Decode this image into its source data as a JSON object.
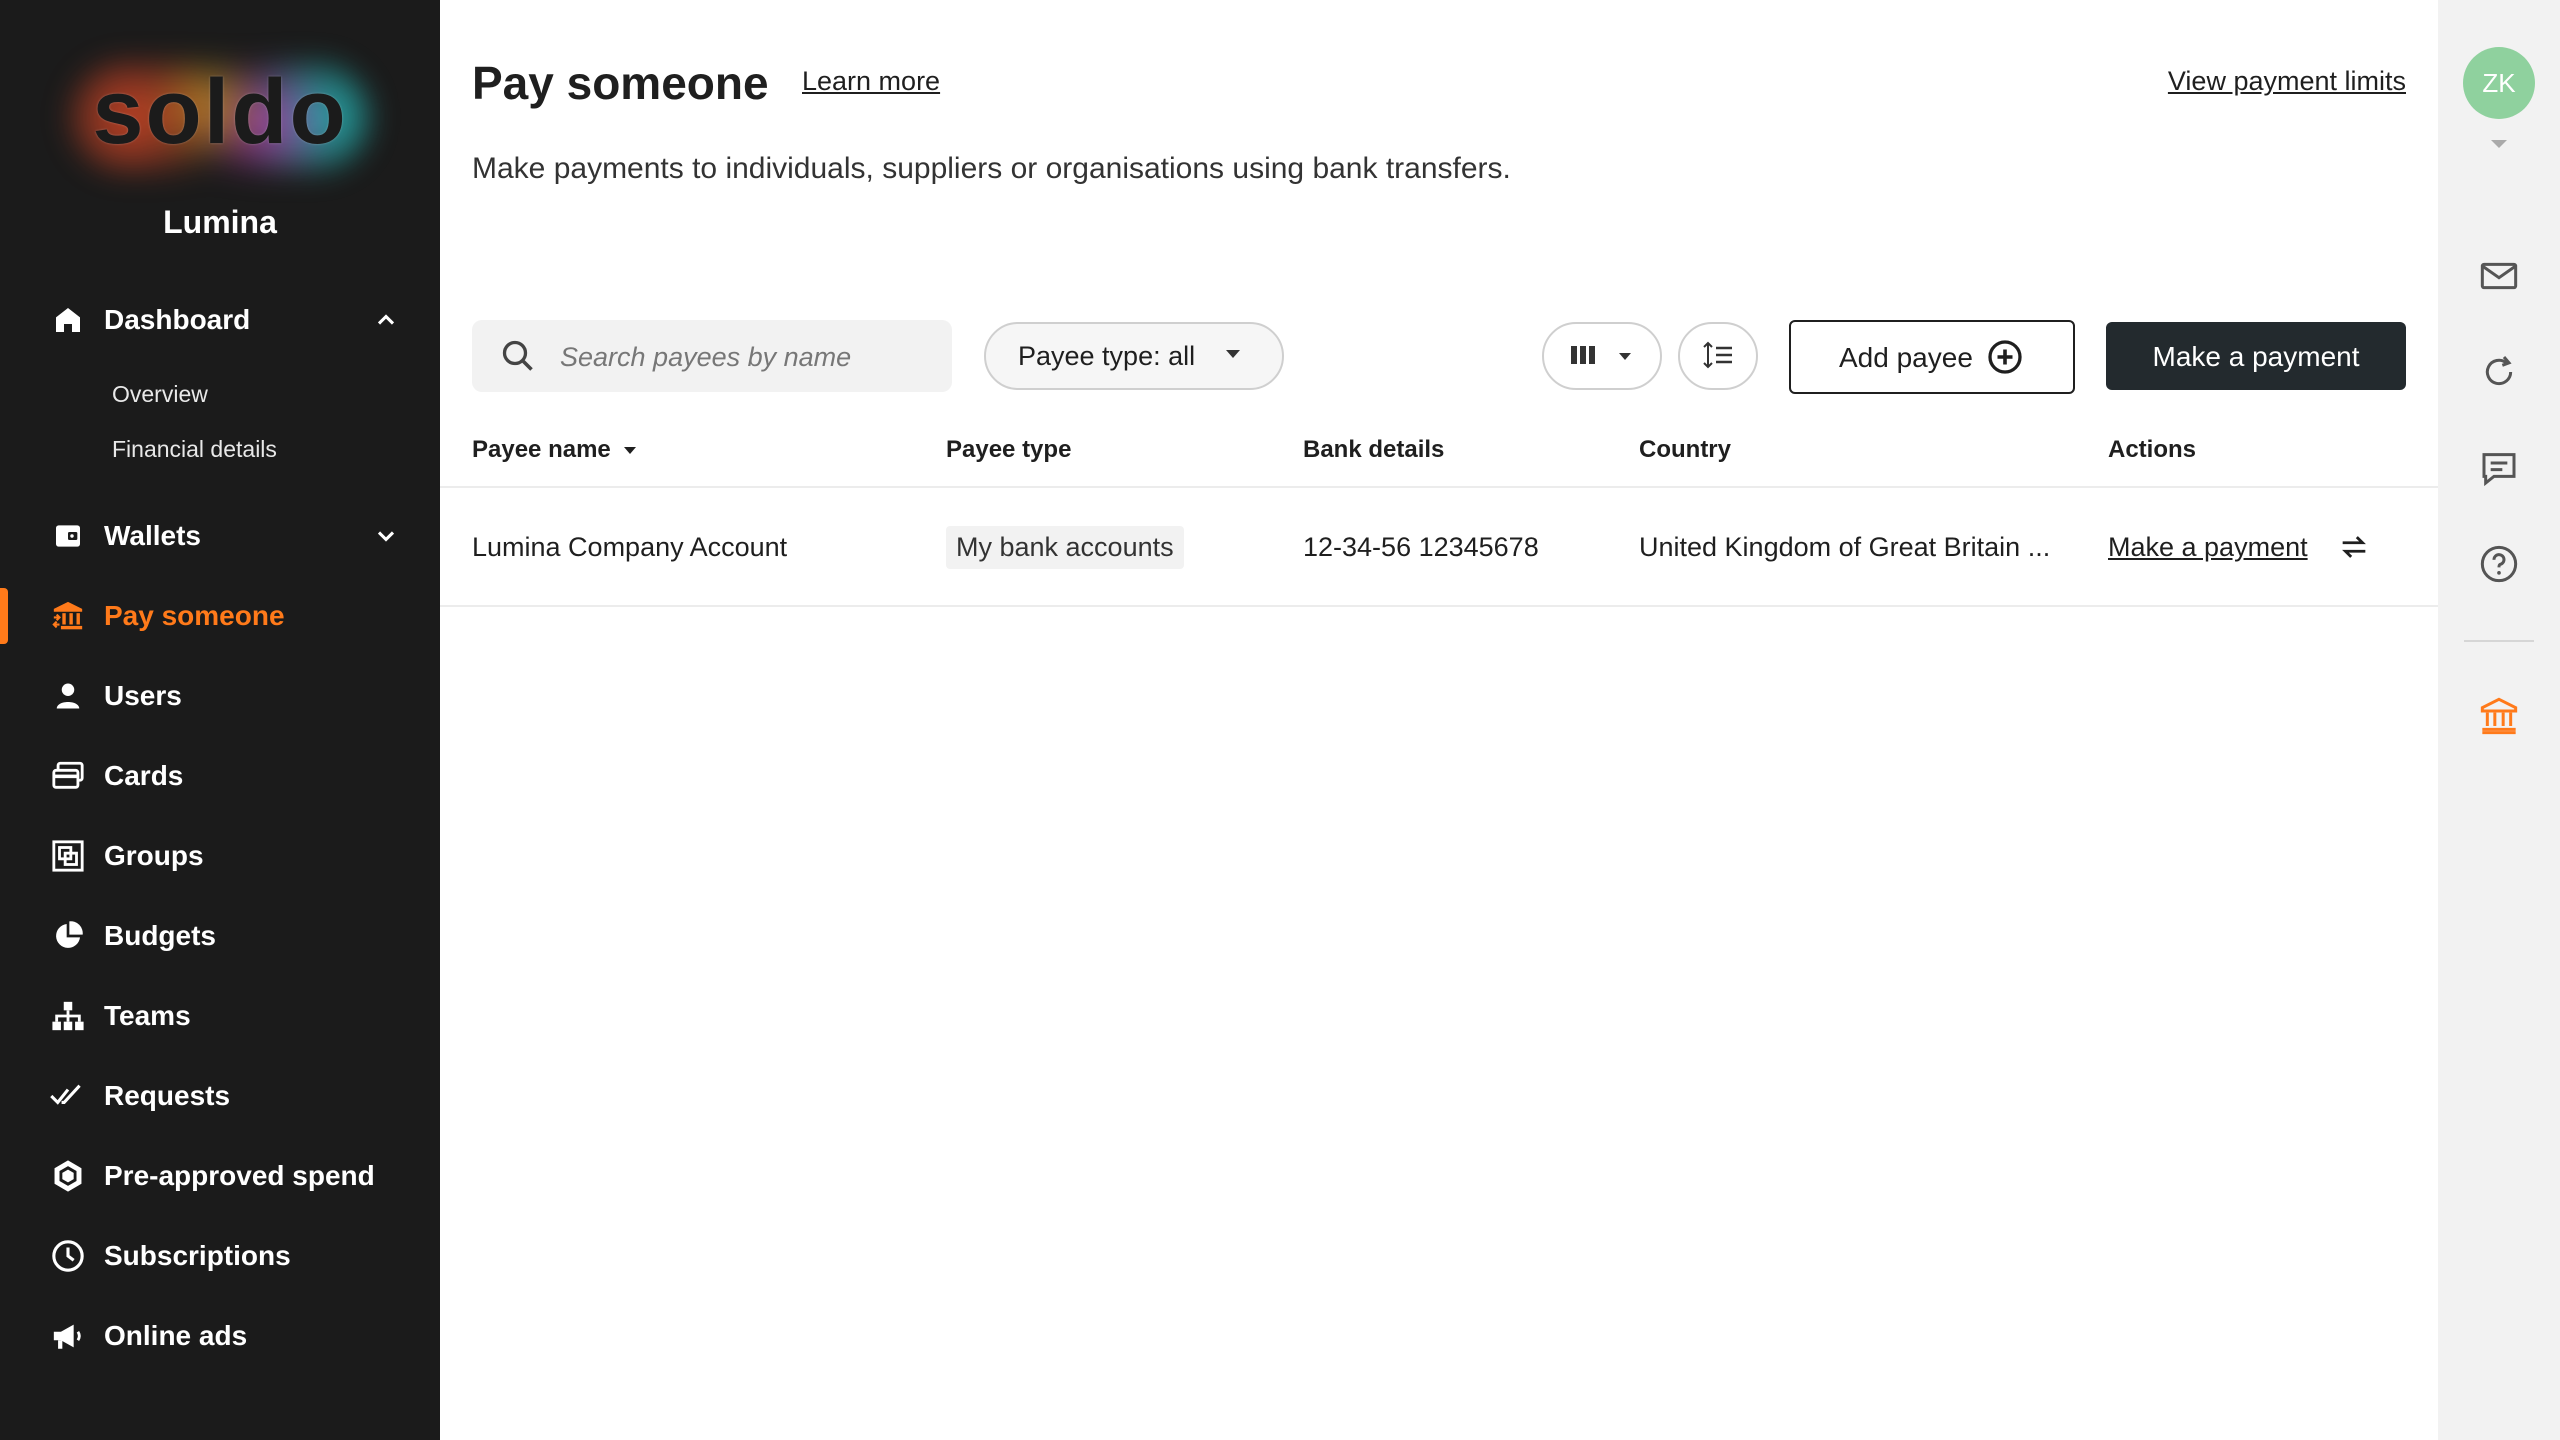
{
  "sidebar": {
    "logo_text": "soldo",
    "org_name": "Lumina",
    "items": [
      {
        "label": "Dashboard",
        "icon": "home-icon"
      },
      {
        "label": "Wallets",
        "icon": "wallet-icon"
      },
      {
        "label": "Pay someone",
        "icon": "bank-transfer-icon"
      },
      {
        "label": "Users",
        "icon": "user-icon"
      },
      {
        "label": "Cards",
        "icon": "cards-icon"
      },
      {
        "label": "Groups",
        "icon": "groups-icon"
      },
      {
        "label": "Budgets",
        "icon": "pie-icon"
      },
      {
        "label": "Teams",
        "icon": "hierarchy-icon"
      },
      {
        "label": "Requests",
        "icon": "double-check-icon"
      },
      {
        "label": "Pre-approved spend",
        "icon": "hexagon-check-icon"
      },
      {
        "label": "Subscriptions",
        "icon": "clock-icon"
      },
      {
        "label": "Online ads",
        "icon": "megaphone-icon"
      }
    ],
    "dashboard_sub": [
      "Overview",
      "Financial details"
    ],
    "active_color": "#ff7a1a"
  },
  "header": {
    "title": "Pay someone",
    "learn_more": "Learn more",
    "view_limits": "View payment limits",
    "subtitle": "Make payments to individuals, suppliers or organisations using bank transfers."
  },
  "toolbar": {
    "search_placeholder": "Search payees by name",
    "filter_label": "Payee type: all",
    "add_payee_label": "Add payee",
    "make_payment_label": "Make a payment"
  },
  "table": {
    "columns": [
      "Payee name",
      "Payee type",
      "Bank details",
      "Country",
      "Actions"
    ],
    "rows": [
      {
        "payee_name": "Lumina Company Account",
        "payee_type": "My bank accounts",
        "bank_details": "12-34-56 12345678",
        "country": "United Kingdom of Great Britain ...",
        "action": "Make a payment"
      }
    ]
  },
  "rail": {
    "avatar_initials": "ZK",
    "avatar_color": "#8fd19e"
  }
}
